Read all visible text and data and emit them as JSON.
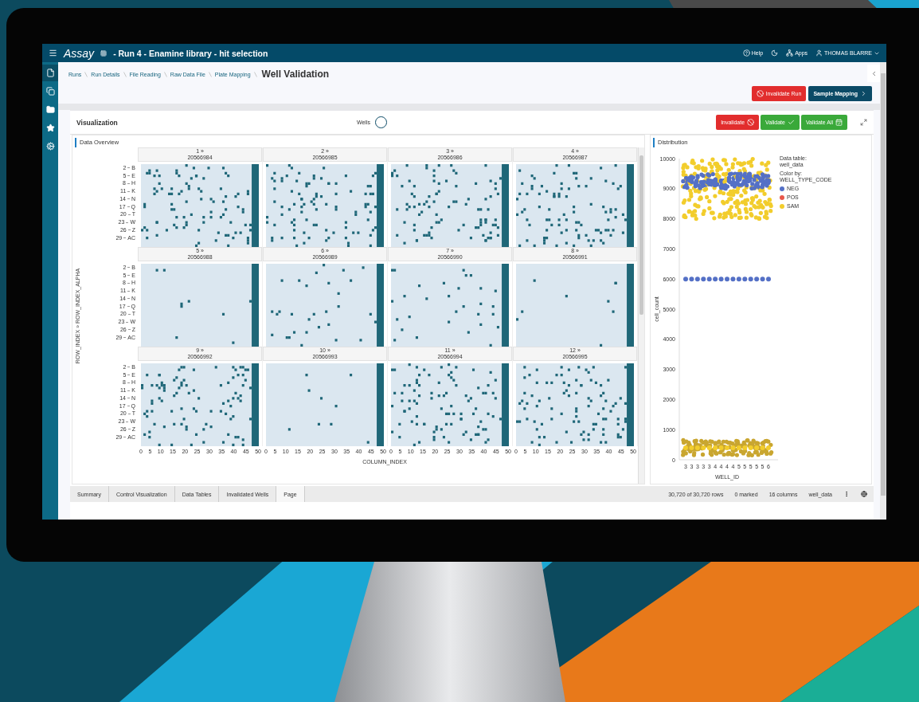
{
  "topbar": {
    "brand": "Assay",
    "title": "- Run 4 - Enamine library - hit selection",
    "menu": [
      {
        "kind": "help",
        "label": "Help"
      },
      {
        "kind": "theme"
      },
      {
        "kind": "apps",
        "label": "Apps"
      },
      {
        "kind": "user",
        "label": "THOMAS BLARRE"
      }
    ]
  },
  "rail": [
    {
      "kind": "file",
      "selected": true
    },
    {
      "kind": "copy",
      "selected": false
    },
    {
      "kind": "folder",
      "selected": false
    },
    {
      "kind": "star",
      "selected": false
    },
    {
      "kind": "settings",
      "selected": false
    }
  ],
  "breadcrumb": [
    "Runs",
    "Run Details",
    "File Reading",
    "Raw Data File",
    "Plate Mapping"
  ],
  "page_title": "Well Validation",
  "page_actions": [
    {
      "kind": "invalidate",
      "label": "Invalidate Run"
    },
    {
      "kind": "next",
      "label": "Sample Mapping"
    }
  ],
  "visualization": {
    "title": "Visualization",
    "toggle_label": "Wells",
    "actions": [
      {
        "kind": "invalidate",
        "label": "Invalidate"
      },
      {
        "kind": "validate",
        "label": "Validate"
      },
      {
        "kind": "validate-all",
        "label": "Validate All"
      }
    ]
  },
  "overview": {
    "title": "Data Overview",
    "y_title": "ROW_INDEX » ROW_INDEX_ALPHA",
    "x_title": "COLUMN_INDEX",
    "plate_rows": [
      {
        "row_ticks": [
          [
            "2",
            "B"
          ],
          [
            "5",
            "E"
          ],
          [
            "8",
            "H"
          ],
          [
            "11",
            "K"
          ],
          [
            "14",
            "N"
          ],
          [
            "17",
            "Q"
          ],
          [
            "20",
            "T"
          ],
          [
            "23",
            "W"
          ],
          [
            "26",
            "Z"
          ],
          [
            "29",
            "AC"
          ]
        ],
        "plates": [
          {
            "index": "1 »",
            "barcode": "20566984",
            "kind": "dense"
          },
          {
            "index": "2 »",
            "barcode": "20566985",
            "kind": "dense"
          },
          {
            "index": "3 »",
            "barcode": "20566986",
            "kind": "dense"
          },
          {
            "index": "4 »",
            "barcode": "20566987",
            "kind": "dense"
          }
        ]
      },
      {
        "row_ticks": [
          [
            "2",
            "B"
          ],
          [
            "5",
            "E"
          ],
          [
            "8",
            "H"
          ],
          [
            "11",
            "K"
          ],
          [
            "14",
            "N"
          ],
          [
            "17",
            "Q"
          ],
          [
            "20",
            "T"
          ],
          [
            "23",
            "W"
          ],
          [
            "26",
            "Z"
          ],
          [
            "29",
            "AC"
          ]
        ],
        "plates": [
          {
            "index": "5 »",
            "barcode": "20566988",
            "kind": "sparse"
          },
          {
            "index": "6 »",
            "barcode": "20566989",
            "kind": "medium"
          },
          {
            "index": "7 »",
            "barcode": "20566990",
            "kind": "medium"
          },
          {
            "index": "8 »",
            "barcode": "20566991",
            "kind": "sparse"
          }
        ]
      },
      {
        "row_ticks": [
          [
            "2",
            "B"
          ],
          [
            "5",
            "E"
          ],
          [
            "8",
            "H"
          ],
          [
            "11",
            "K"
          ],
          [
            "14",
            "N"
          ],
          [
            "17",
            "Q"
          ],
          [
            "20",
            "T"
          ],
          [
            "23",
            "W"
          ],
          [
            "26",
            "Z"
          ],
          [
            "29",
            "AC"
          ]
        ],
        "plates": [
          {
            "index": "9 »",
            "barcode": "20566992",
            "kind": "dense"
          },
          {
            "index": "10 »",
            "barcode": "20566993",
            "kind": "sparse"
          },
          {
            "index": "11 »",
            "barcode": "20566994",
            "kind": "dense"
          },
          {
            "index": "12 »",
            "barcode": "20566995",
            "kind": "dense"
          }
        ]
      }
    ],
    "column_ticks": [
      [
        "0",
        "5",
        "10",
        "15",
        "20",
        "25",
        "30",
        "35",
        "40",
        "45",
        "50"
      ],
      [
        "0",
        "5",
        "10",
        "15",
        "20",
        "25",
        "30",
        "35",
        "40",
        "45",
        "50"
      ],
      [
        "0",
        "5",
        "10",
        "15",
        "20",
        "25",
        "30",
        "35",
        "40",
        "45",
        "50"
      ],
      [
        "0",
        "5",
        "10",
        "15",
        "20",
        "25",
        "30",
        "35",
        "40",
        "45",
        "50"
      ]
    ]
  },
  "distribution": {
    "title": "Distribution",
    "legend_caption_1": "Data table:",
    "legend_table": "well_data",
    "legend_caption_2": "Color by:",
    "legend_column": "WELL_TYPE_CODE",
    "chart_data": {
      "type": "scatter",
      "xlabel": "WELL_ID",
      "ylabel": "cell_count",
      "categories": [
        "3",
        "3",
        "3",
        "3",
        "3",
        "4",
        "4",
        "4",
        "4",
        "5",
        "5",
        "5",
        "5",
        "5",
        "6"
      ],
      "ylim": [
        0,
        10000
      ],
      "yticks": [
        0,
        1000,
        2000,
        3000,
        4000,
        5000,
        6000,
        7000,
        8000,
        9000,
        10000
      ],
      "series": [
        {
          "name": "NEG",
          "color": "#5470c6",
          "values": [
            6000,
            6000,
            6000,
            6000,
            6000,
            6000,
            6000,
            6000,
            6000,
            6000,
            6000,
            6000,
            6000,
            6000,
            6000
          ]
        },
        {
          "name": "POS",
          "color": "#e8574a",
          "values": [
            null,
            null,
            null,
            null,
            null,
            null,
            null,
            null,
            null,
            null,
            null,
            null,
            null,
            null,
            null
          ]
        },
        {
          "name": "SAM",
          "color": "#f2cd2c",
          "values": [
            400,
            400,
            400,
            400,
            400,
            400,
            400,
            400,
            400,
            400,
            400,
            400,
            400,
            400,
            400
          ]
        }
      ]
    }
  },
  "tabs": [
    {
      "label": "Summary",
      "selected": false
    },
    {
      "label": "Control Visualization",
      "selected": false
    },
    {
      "label": "Data Tables",
      "selected": false
    },
    {
      "label": "Invalidated Wells",
      "selected": false
    },
    {
      "label": "Page",
      "selected": true
    }
  ],
  "status": [
    "30,720 of 30,720 rows",
    "0 marked",
    "16 columns",
    "well_data"
  ]
}
